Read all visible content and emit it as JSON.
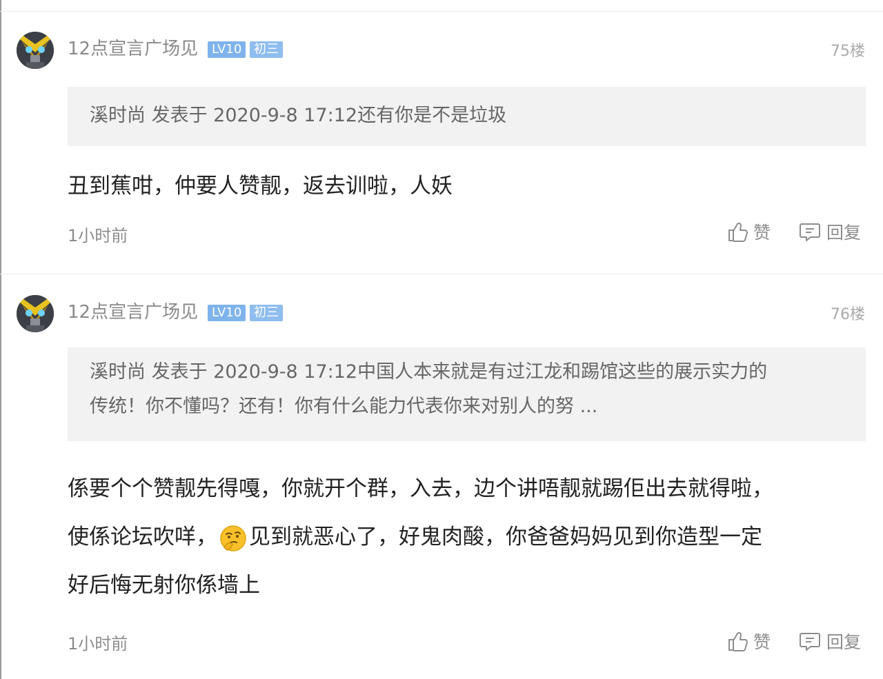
{
  "posts": [
    {
      "username": "12点宣言广场见",
      "level_badge": "LV10",
      "grade_badge": "初三",
      "floor": "75楼",
      "quote": "溪时尚 发表于 2020-9-8 17:12还有你是不是垃圾",
      "body": "丑到蕉咁，仲要人赞靓，返去训啦，人妖",
      "time": "1小时前",
      "like_label": "赞",
      "reply_label": "回复"
    },
    {
      "username": "12点宣言广场见",
      "level_badge": "LV10",
      "grade_badge": "初三",
      "floor": "76楼",
      "quote_line1": "溪时尚 发表于 2020-9-8 17:12中国人本来就是有过江龙和踢馆这些的展示实力的",
      "quote_line2": "传统！你不懂吗？还有！你有什么能力代表你来对别人的努 ...",
      "body_line1": "係要个个赞靓先得嘎，你就开个群，入去，边个讲唔靓就踢佢出去就得啦，",
      "body_line2_a": "使係论坛吹咩，",
      "body_line2_b": "见到就恶心了，好鬼肉酸，你爸爸妈妈见到你造型一定",
      "body_line3": "好后悔无射你係墙上",
      "time": "1小时前",
      "like_label": "赞",
      "reply_label": "回复"
    }
  ],
  "colors": {
    "badge_blue": "#7fb3ec",
    "quote_bg": "#f2f2f2",
    "meta_gray": "#8c8c8c"
  },
  "icons": [
    "avatar-image",
    "thumbs-up-icon",
    "comment-icon",
    "thinking-emoji-icon"
  ]
}
